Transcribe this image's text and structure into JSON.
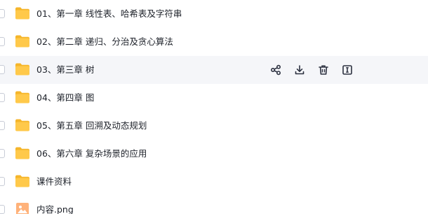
{
  "files": [
    {
      "name": "01、第一章 线性表、哈希表及字符串",
      "icon": "folder-icon",
      "type": "folder"
    },
    {
      "name": "02、第二章 递归、分治及贪心算法",
      "icon": "folder-icon",
      "type": "folder"
    },
    {
      "name": "03、第三章 树",
      "icon": "folder-icon",
      "type": "folder",
      "hovered": true
    },
    {
      "name": "04、第四章 图",
      "icon": "folder-icon",
      "type": "folder"
    },
    {
      "name": "05、第五章 回溯及动态规划",
      "icon": "folder-icon",
      "type": "folder"
    },
    {
      "name": "06、第六章 复杂场景的应用",
      "icon": "folder-icon",
      "type": "folder"
    },
    {
      "name": "课件资料",
      "icon": "folder-icon",
      "type": "folder"
    },
    {
      "name": "内容.png",
      "icon": "image-file-icon",
      "type": "image"
    }
  ],
  "row_actions": [
    {
      "icon": "share-icon"
    },
    {
      "icon": "download-icon"
    },
    {
      "icon": "delete-icon"
    },
    {
      "icon": "rename-icon"
    }
  ],
  "colors": {
    "folder": "#ffc94a",
    "folder_tab": "#f5b52a",
    "hover_bg": "#f5f6f9",
    "text": "#1d2129",
    "action_icon": "#2c3140",
    "image_file": "#ffb27a"
  }
}
